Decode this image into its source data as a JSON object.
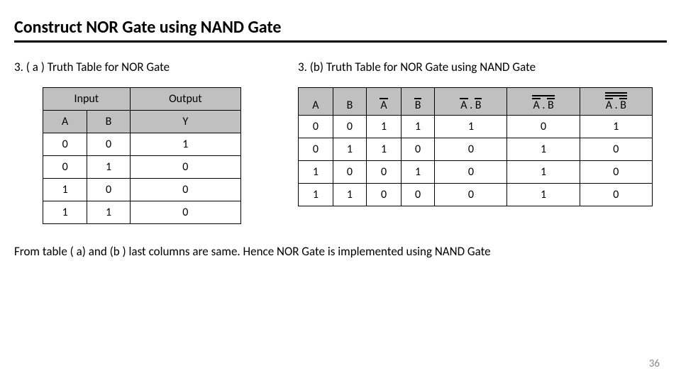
{
  "title": "Construct NOR Gate using NAND Gate",
  "leftCaption": "3.  ( a ) Truth Table for NOR Gate",
  "rightCaption": "3.   (b) Truth Table for NOR Gate using NAND Gate",
  "leftTable": {
    "headerGroup": {
      "input": "Input",
      "output": "Output"
    },
    "headers": [
      "A",
      "B",
      "Y"
    ],
    "rows": [
      [
        "0",
        "0",
        "1"
      ],
      [
        "0",
        "1",
        "0"
      ],
      [
        "1",
        "0",
        "0"
      ],
      [
        "1",
        "1",
        "0"
      ]
    ]
  },
  "rightTable": {
    "headers": [
      "A",
      "B",
      "A",
      "B",
      "A . B",
      "A . B",
      "A . B"
    ],
    "headerOverlines": [
      0,
      0,
      1,
      1,
      2,
      3,
      4
    ],
    "rows": [
      [
        "0",
        "0",
        "1",
        "1",
        "1",
        "0",
        "1"
      ],
      [
        "0",
        "1",
        "1",
        "0",
        "0",
        "1",
        "0"
      ],
      [
        "1",
        "0",
        "0",
        "1",
        "0",
        "1",
        "0"
      ],
      [
        "1",
        "1",
        "0",
        "0",
        "0",
        "1",
        "0"
      ]
    ]
  },
  "conclusion": "From table ( a) and (b ) last columns are same. Hence NOR Gate is implemented using NAND Gate",
  "pageNumber": "36",
  "chart_data": [
    {
      "type": "table",
      "title": "Truth Table for NOR Gate",
      "columns": [
        "A",
        "B",
        "Y"
      ],
      "rows": [
        [
          0,
          0,
          1
        ],
        [
          0,
          1,
          0
        ],
        [
          1,
          0,
          0
        ],
        [
          1,
          1,
          0
        ]
      ]
    },
    {
      "type": "table",
      "title": "Truth Table for NOR Gate using NAND Gate",
      "columns": [
        "A",
        "B",
        "not A",
        "not B",
        "notA·notB",
        "not(notA·notB)",
        "not(not(notA·notB))"
      ],
      "rows": [
        [
          0,
          0,
          1,
          1,
          1,
          0,
          1
        ],
        [
          0,
          1,
          1,
          0,
          0,
          1,
          0
        ],
        [
          1,
          0,
          0,
          1,
          0,
          1,
          0
        ],
        [
          1,
          1,
          0,
          0,
          0,
          1,
          0
        ]
      ]
    }
  ]
}
